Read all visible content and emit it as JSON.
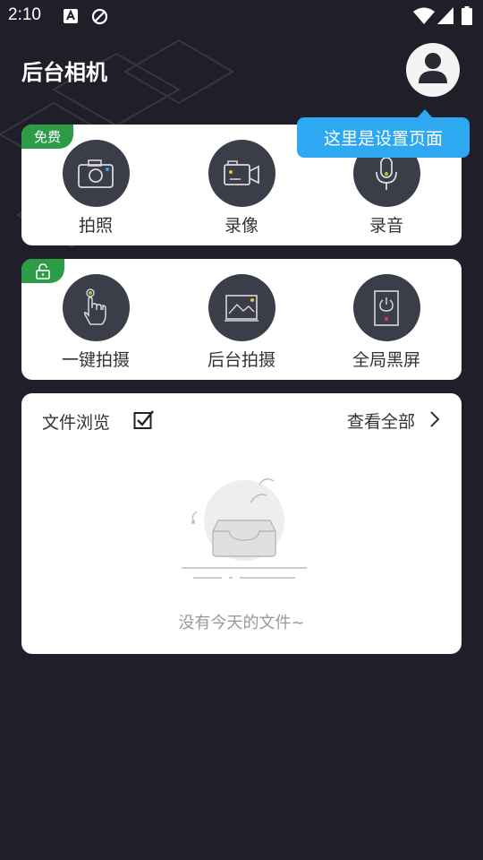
{
  "status_bar": {
    "time": "2:10"
  },
  "header": {
    "title": "后台相机",
    "avatar_icon": "user-icon"
  },
  "tooltip": {
    "text": "这里是设置页面"
  },
  "card_free": {
    "badge": "免费",
    "items": [
      {
        "label": "拍照",
        "icon": "camera-icon"
      },
      {
        "label": "录像",
        "icon": "video-camera-icon"
      },
      {
        "label": "录音",
        "icon": "microphone-icon"
      }
    ]
  },
  "card_locked": {
    "badge_icon": "unlock-icon",
    "items": [
      {
        "label": "一键拍摄",
        "icon": "tap-finger-icon"
      },
      {
        "label": "后台拍摄",
        "icon": "picture-frame-icon"
      },
      {
        "label": "全局黑屏",
        "icon": "power-icon"
      }
    ]
  },
  "file_browse": {
    "title": "文件浏览",
    "view_all": "查看全部",
    "empty_text": "没有今天的文件~"
  },
  "colors": {
    "background": "#1f1f2a",
    "badge_green": "#2e9b46",
    "tooltip_blue": "#2ea8f0",
    "icon_circle": "#3b3d48"
  }
}
